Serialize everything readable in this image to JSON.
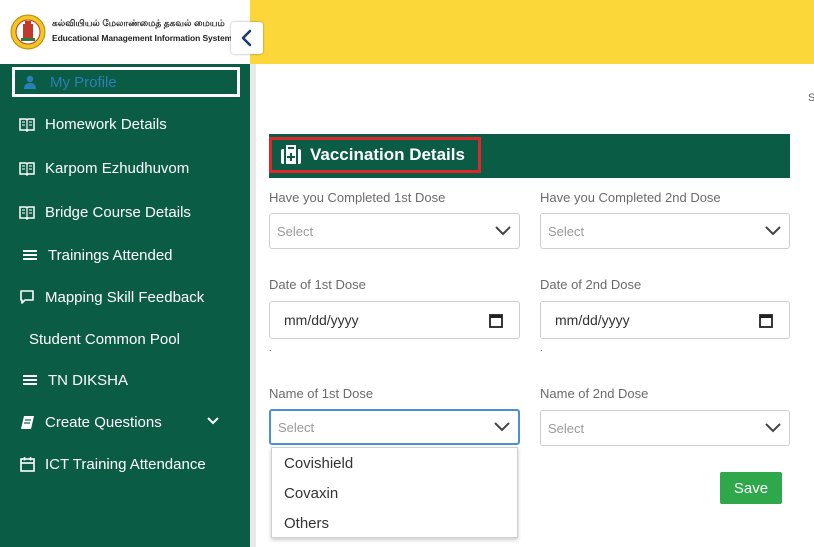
{
  "header": {
    "logo_tamil": "கல்வியியல் மேலாண்மைத் தகவல் மையம்",
    "logo_english": "Educational Management Information System"
  },
  "sidebar": {
    "profile_label": "My Profile",
    "items": [
      {
        "label": "Homework Details",
        "icon": "book-icon"
      },
      {
        "label": "Karpom Ezhudhuvom",
        "icon": "book-icon"
      },
      {
        "label": "Bridge Course Details",
        "icon": "book-icon"
      },
      {
        "label": "Trainings Attended",
        "icon": "list-icon"
      },
      {
        "label": "Mapping Skill Feedback",
        "icon": "comment-icon"
      },
      {
        "label": "Student Common Pool",
        "icon": ""
      },
      {
        "label": "TN DIKSHA",
        "icon": "list-icon"
      },
      {
        "label": "Create Questions",
        "icon": "notebook-icon"
      },
      {
        "label": "ICT Training Attendance",
        "icon": "calendar-icon"
      }
    ]
  },
  "edge_char": "S",
  "section": {
    "title": "Vaccination Details",
    "icon": "medical-kit-icon"
  },
  "form": {
    "dose1_completed_label": "Have you Completed 1st Dose",
    "dose1_completed_value": "Select",
    "dose2_completed_label": "Have you Completed 2nd Dose",
    "dose2_completed_value": "Select",
    "date1_label": "Date of 1st Dose",
    "date1_placeholder": "mm/dd/yyyy",
    "date2_label": "Date of 2nd Dose",
    "date2_placeholder": "mm/dd/yyyy",
    "date1_note": ".",
    "date2_note": ".",
    "name1_label": "Name of 1st Dose",
    "name1_value": "Select",
    "name2_label": "Name of 2nd Dose",
    "name2_value": "Select",
    "dropdown_options": [
      "Covishield",
      "Covaxin",
      "Others"
    ],
    "save_label": "Save"
  },
  "colors": {
    "topbar": "#fcd73a",
    "sidebar": "#0b5c45",
    "section_header": "#0b5c45",
    "highlight_border": "#e0262a",
    "save_button": "#2ea84a",
    "active_border": "#4a90d6"
  }
}
